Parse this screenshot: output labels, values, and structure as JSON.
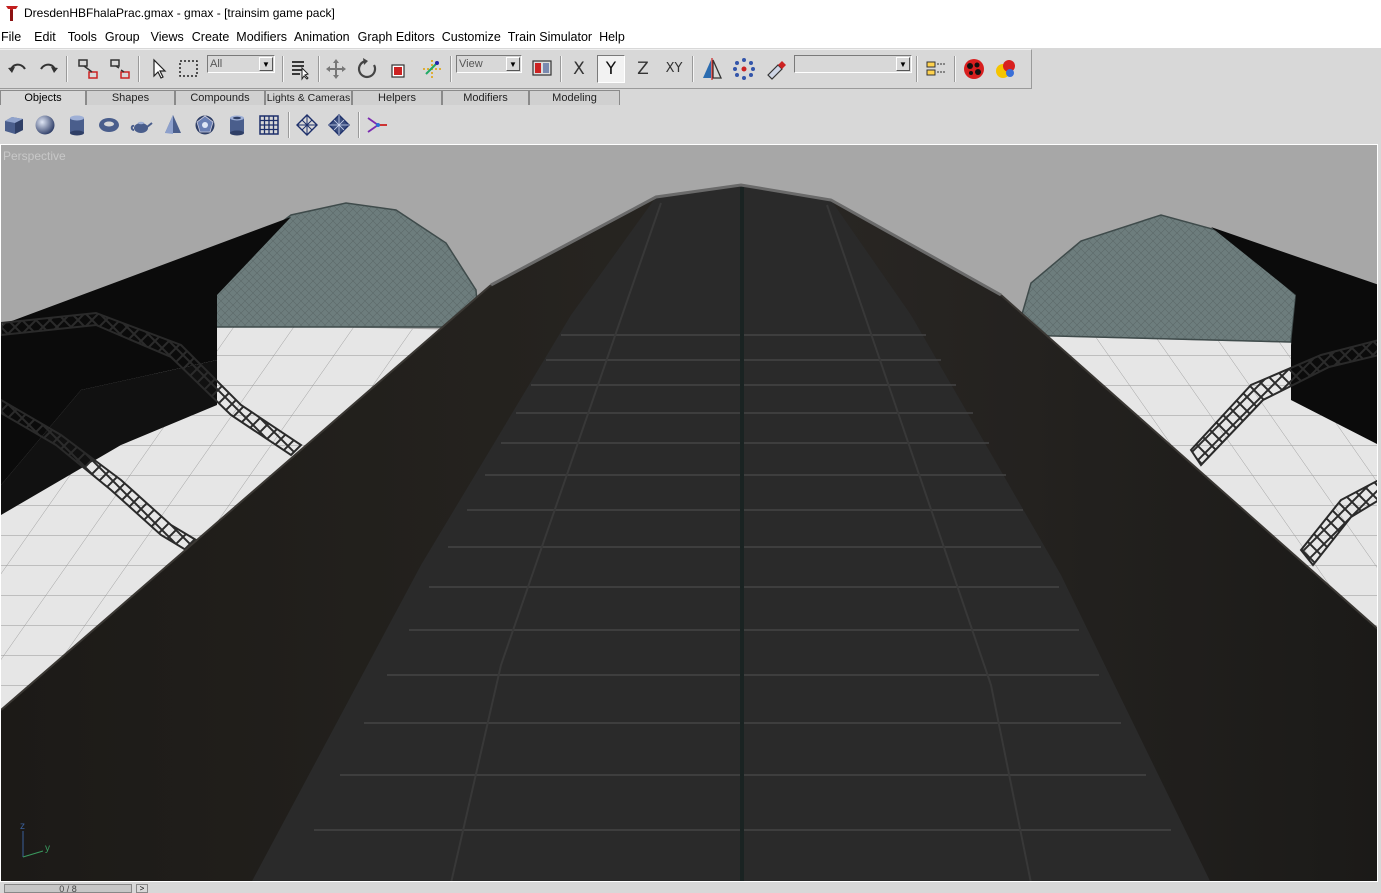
{
  "window": {
    "title": "DresdenHBFhalaPrac.gmax - gmax - [trainsim game pack]"
  },
  "menu": [
    "File",
    "Edit",
    "Tools",
    "Group",
    "Views",
    "Create",
    "Modifiers",
    "Animation",
    "Graph Editors",
    "Customize",
    "Train Simulator",
    "Help"
  ],
  "toolbar": {
    "selection_filter": "All",
    "reference_coord": "View",
    "axis_x": "X",
    "axis_y": "Y",
    "axis_z": "Z",
    "axis_xy": "XY",
    "named_selection": ""
  },
  "tabs": [
    "Objects",
    "Shapes",
    "Compounds",
    "Lights & Cameras",
    "Helpers",
    "Modifiers",
    "Modeling"
  ],
  "active_tab": "Objects",
  "viewport": {
    "label": "Perspective",
    "axis_z": "z",
    "axis_y": "y"
  },
  "status": {
    "time_slider": "0 / 8"
  },
  "colors": {
    "viewport_bg": "#a7a7a7",
    "roof_dark": "#2a2a2a",
    "dome": "#6b7b7b",
    "ground": "#e4e4e4"
  }
}
